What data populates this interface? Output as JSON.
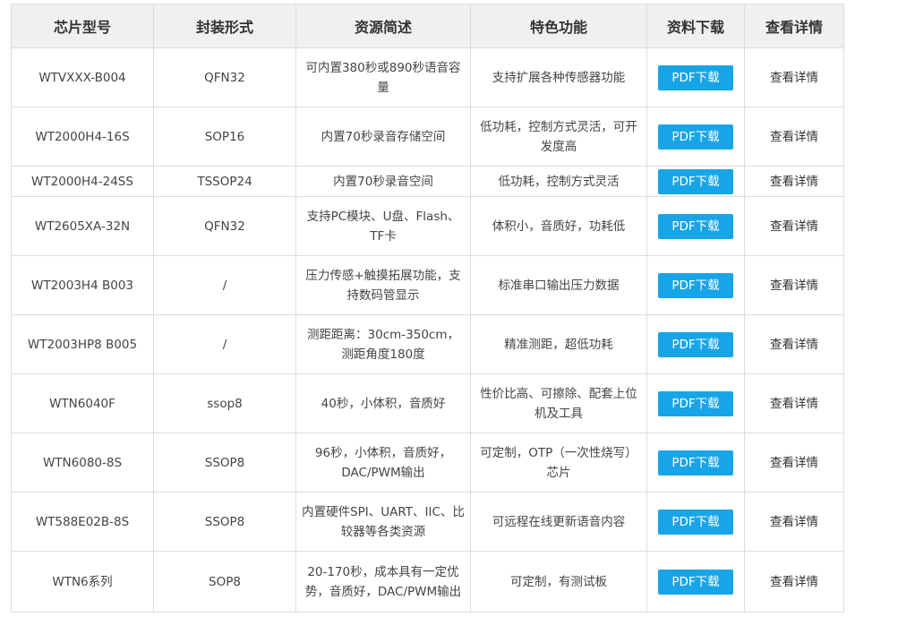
{
  "table": {
    "headers": [
      "芯片型号",
      "封装形式",
      "资源简述",
      "特色功能",
      "资料下载",
      "查看详情"
    ],
    "pdf_label": "PDF下载",
    "detail_label": "查看详情",
    "rows": [
      {
        "model": "WTVXXX-B004",
        "package": "QFN32",
        "resources": "可内置380秒或890秒语音容量",
        "features": "支持扩展各种传感器功能"
      },
      {
        "model": "WT2000H4-16S",
        "package": "SOP16",
        "resources": "内置70秒录音存储空间",
        "features": "低功耗，控制方式灵活，可开发度高"
      },
      {
        "model": "WT2000H4-24SS",
        "package": "TSSOP24",
        "resources": "内置70秒录音空间",
        "features": "低功耗，控制方式灵活"
      },
      {
        "model": "WT2605XA-32N",
        "package": "QFN32",
        "resources": "支持PC模块、U盘、Flash、TF卡",
        "features": "体积小，音质好，功耗低"
      },
      {
        "model": "WT2003H4 B003",
        "package": "/",
        "resources": "压力传感+触摸拓展功能，支持数码管显示",
        "features": "标准串口输出压力数据"
      },
      {
        "model": "WT2003HP8 B005",
        "package": "/",
        "resources": "测距距离：30cm-350cm，测距角度180度",
        "features": "精准测距，超低功耗"
      },
      {
        "model": "WTN6040F",
        "package": "ssop8",
        "resources": "40秒，小体积，音质好",
        "features": "性价比高、可擦除、配套上位机及工具"
      },
      {
        "model": "WTN6080-8S",
        "package": "SSOP8",
        "resources": "96秒，小体积，音质好，DAC/PWM输出",
        "features": "可定制，OTP（一次性烧写）芯片"
      },
      {
        "model": "WT588E02B-8S",
        "package": "SSOP8",
        "resources": "内置硬件SPI、UART、IIC、比较器等各类资源",
        "features": "可远程在线更新语音内容"
      },
      {
        "model": "WTN6系列",
        "package": "SOP8",
        "resources": "20-170秒，成本具有一定优势，音质好，DAC/PWM输出",
        "features": "可定制，有测试板"
      }
    ]
  }
}
